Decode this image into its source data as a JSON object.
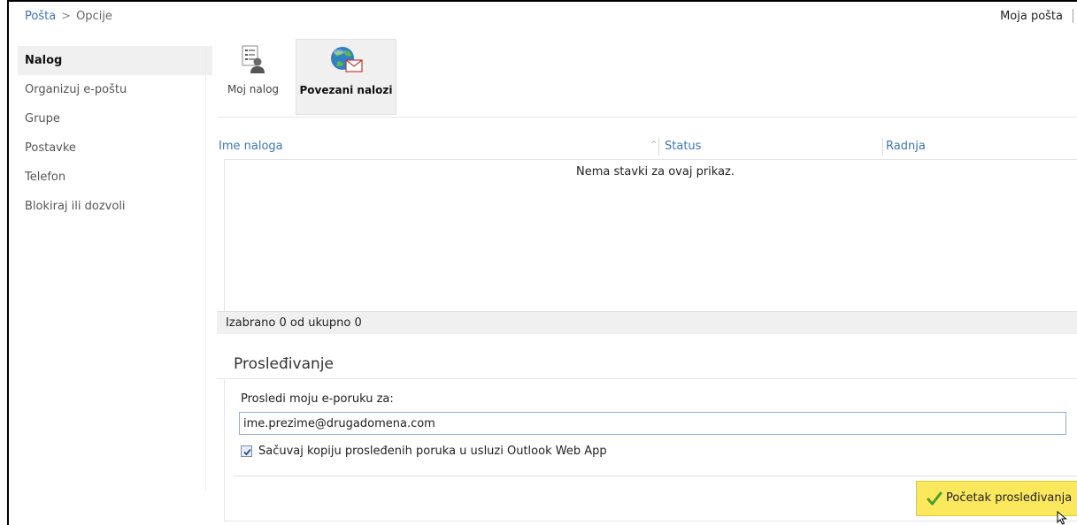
{
  "breadcrumb": {
    "root": "Pošta",
    "separator": ">",
    "current": "Opcije"
  },
  "header": {
    "my_mail": "Moja pošta"
  },
  "sidebar": {
    "items": [
      {
        "label": "Nalog",
        "active": true
      },
      {
        "label": "Organizuj e-poštu",
        "active": false
      },
      {
        "label": "Grupe",
        "active": false
      },
      {
        "label": "Postavke",
        "active": false
      },
      {
        "label": "Telefon",
        "active": false
      },
      {
        "label": "Blokiraj ili dozvoli",
        "active": false
      }
    ]
  },
  "toolbar": {
    "my_account": "Moj nalog",
    "connected_accounts": "Povezani nalozi"
  },
  "grid": {
    "columns": [
      "Ime naloga",
      "Status",
      "Radnja"
    ],
    "empty_text": "Nema stavki za ovaj prikaz.",
    "status_text": "Izabrano 0 od ukupno 0"
  },
  "forwarding": {
    "title": "Prosleđivanje",
    "label": "Prosledi moju e-poruku za:",
    "email_value": "ime.prezime@drugadomena.com",
    "keep_copy_label": "Sačuvaj kopiju prosleđenih poruka u usluzi Outlook Web App",
    "keep_copy_checked": true,
    "start_button": "Početak prosleđivanja"
  },
  "colors": {
    "link": "#3a77b8",
    "button_yellow": "#fce85d",
    "selected_bg": "#f0f0f0"
  }
}
